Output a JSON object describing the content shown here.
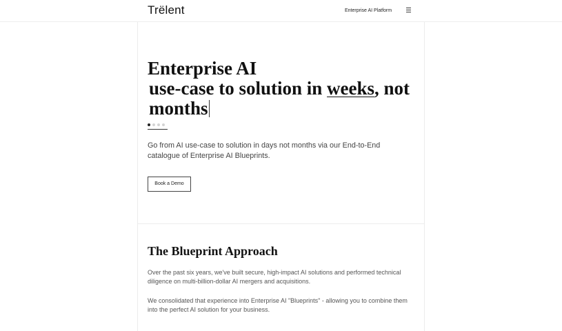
{
  "header": {
    "logo": "Trëlent",
    "nav_link": "Enterprise AI Platform",
    "menu_icon": "hamburger-menu-icon"
  },
  "hero": {
    "title_line1": "Enterprise AI",
    "title_line2_pre": "use-case to solution in ",
    "title_line2_underlined": "weeks",
    "title_line2_post": ", not",
    "title_line3": "months",
    "carousel": {
      "count": 4,
      "active": 1
    },
    "subtitle": "Go from AI use-case to solution in days not months via our End-to-End catalogue of Enterprise AI Blueprints.",
    "cta_label": "Book a Demo"
  },
  "blueprint": {
    "title": "The Blueprint Approach",
    "paragraph1": "Over the past six years, we've built secure, high-impact AI solutions and performed technical diligence on multi-billion-dollar AI mergers and acquisitions.",
    "paragraph2": "We consolidated that experience into Enterprise AI \"Blueprints\" - allowing you to combine them into the perfect AI solution for your business."
  },
  "colors": {
    "background": "#ffffff",
    "text": "#111111",
    "muted_text": "#555555",
    "border": "#ececec"
  }
}
